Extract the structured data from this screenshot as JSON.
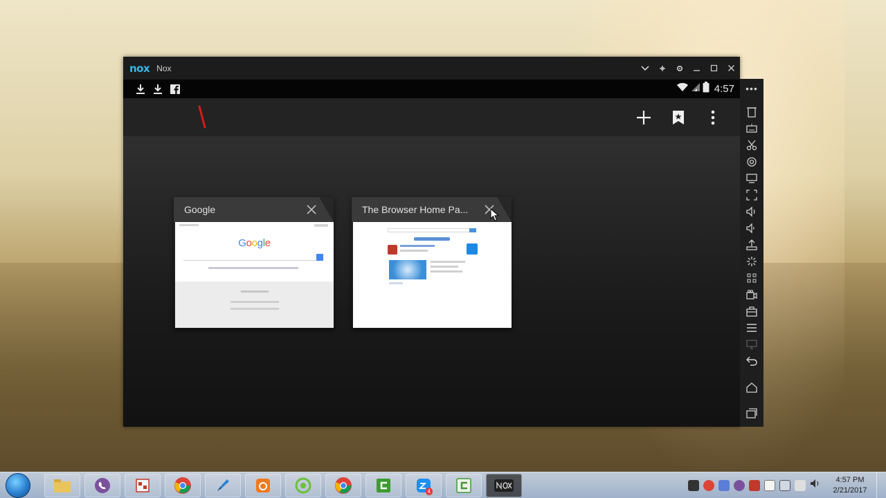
{
  "window": {
    "logo": "nox",
    "title": "Nox",
    "controls": [
      "chevron-down-icon",
      "pin-icon",
      "gear-icon",
      "minimize-icon",
      "maximize-icon",
      "close-icon"
    ]
  },
  "statusbar": {
    "left_icons": [
      "download-icon",
      "download-icon",
      "facebook-icon"
    ],
    "time": "4:57"
  },
  "browser_toolbar": {
    "actions": [
      "add-tab-icon",
      "bookmark-icon",
      "overflow-menu-icon"
    ]
  },
  "tabs": [
    {
      "title": "Google",
      "thumbnail": {
        "logo_letters": [
          "G",
          "o",
          "o",
          "g",
          "l",
          "e"
        ],
        "logo_colors": [
          "#4285f4",
          "#ea4335",
          "#fbbc05",
          "#4285f4",
          "#34a853",
          "#ea4335"
        ]
      }
    },
    {
      "title": "The Browser Home Pa...",
      "thumbnail": {}
    }
  ],
  "side_toolbar": {
    "more": "•••",
    "items": [
      "apk-install-icon",
      "keyboard-icon",
      "scissors-icon",
      "location-icon",
      "screen-icon",
      "fullscreen-icon",
      "volume-up-icon",
      "volume-down-icon",
      "upload-icon",
      "shake-icon",
      "multi-instance-icon",
      "video-record-icon",
      "toolbox-icon",
      "menu-icon",
      "screen-share-icon",
      "back-icon",
      "home-icon",
      "recent-apps-icon"
    ]
  },
  "taskbar": {
    "apps": [
      "start-menu",
      "file-explorer",
      "viber",
      "office-app",
      "chrome",
      "pen-app",
      "uc-browser",
      "coccoc",
      "chrome-alt",
      "camtasia",
      "zalo",
      "camtasia-recorder",
      "nox"
    ],
    "zalo_badge": "4",
    "clock_time": "4:57 PM",
    "clock_date": "2/21/2017"
  },
  "colors": {
    "nox_accent": "#37b7e6",
    "window_bg": "#151515",
    "tab_header": "#3a3a3a"
  }
}
